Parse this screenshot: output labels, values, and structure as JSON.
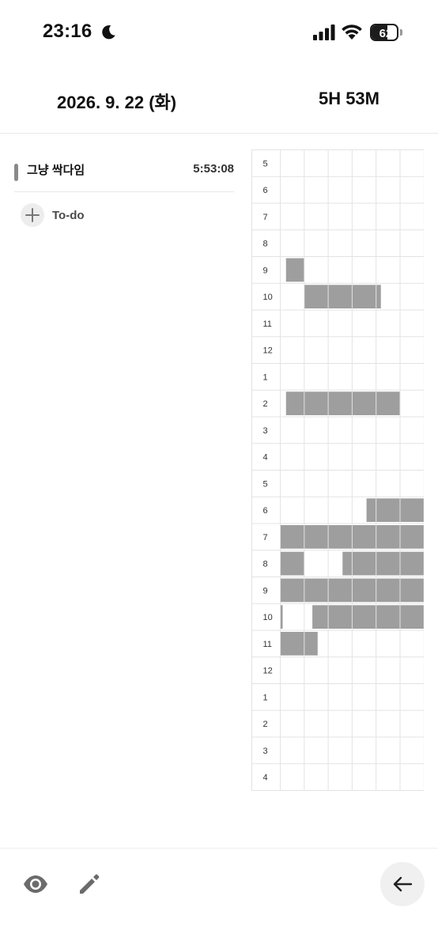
{
  "status_bar": {
    "time": "23:16",
    "battery": "62",
    "battery_level": 0.62,
    "icons": [
      "moon-icon",
      "cellular-signal-icon",
      "wifi-icon",
      "battery-icon"
    ]
  },
  "header": {
    "date": "2026. 9. 22 (화)",
    "total": "5H 53M"
  },
  "subject": {
    "name": "그냥 싹다임",
    "time": "5:53:08",
    "color": "#8a8a8a"
  },
  "todo": {
    "label": "To-do",
    "icon": "plus-icon"
  },
  "timetable": {
    "hours": [
      "5",
      "6",
      "7",
      "8",
      "9",
      "10",
      "11",
      "12",
      "1",
      "2",
      "3",
      "4",
      "5",
      "6",
      "7",
      "8",
      "9",
      "10",
      "11",
      "12",
      "1",
      "2",
      "3",
      "4"
    ],
    "fill_color": "#9e9e9e",
    "filled": [
      {
        "row": 4,
        "start": 0.12,
        "end": 0.5
      },
      {
        "row": 5,
        "start": 0.5,
        "end": 2.1
      },
      {
        "row": 9,
        "start": 0.12,
        "end": 2.5
      },
      {
        "row": 13,
        "start": 1.8,
        "end": 3.0
      },
      {
        "row": 14,
        "start": 0.0,
        "end": 3.0
      },
      {
        "row": 15,
        "start": 0.0,
        "end": 0.5
      },
      {
        "row": 15,
        "start": 1.3,
        "end": 3.0
      },
      {
        "row": 16,
        "start": 0.0,
        "end": 3.0
      },
      {
        "row": 17,
        "start": 0.0,
        "end": 0.05
      },
      {
        "row": 17,
        "start": 0.67,
        "end": 3.0
      },
      {
        "row": 18,
        "start": 0.0,
        "end": 0.78
      }
    ],
    "x_unit": "sub-hour cells (0-3, each = 20 min? per row of 6 cells = 60 min)"
  },
  "bottom_bar": {
    "icons": [
      "eye-icon",
      "pencil-icon",
      "arrow-left-icon"
    ]
  }
}
